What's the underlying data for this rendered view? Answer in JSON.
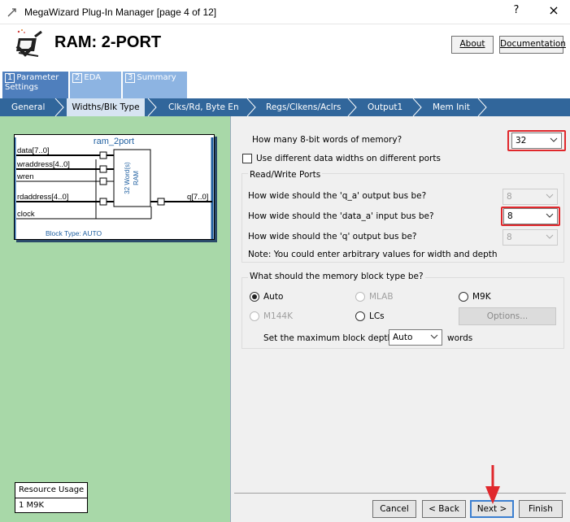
{
  "window": {
    "title": "MegaWizard Plug-In Manager [page 4 of 12]",
    "help": "?",
    "close": "×"
  },
  "header": {
    "title": "RAM: 2-PORT",
    "about_label": "About",
    "documentation_label": "Documentation"
  },
  "steps": [
    {
      "num": "1",
      "label": "Parameter Settings"
    },
    {
      "num": "2",
      "label": "EDA"
    },
    {
      "num": "3",
      "label": "Summary"
    }
  ],
  "tabs": [
    "General",
    "Widths/Blk Type",
    "Clks/Rd, Byte En",
    "Regs/Clkens/Aclrs",
    "Output1",
    "Mem Init"
  ],
  "symbol": {
    "name": "ram_2port",
    "inputs": [
      "data[7..0]",
      "wraddress[4..0]",
      "wren",
      "rdaddress[4..0]",
      "clock"
    ],
    "output": "q[7..0]",
    "block_text_1": "32 Word(s)",
    "block_text_2": "RAM",
    "block_type": "Block Type: AUTO"
  },
  "resource": {
    "title": "Resource Usage",
    "value": "1 M9K"
  },
  "form": {
    "words_question": "How many 8-bit words of memory?",
    "words_value": "32",
    "diff_widths_label": "Use different data widths on different ports",
    "rw_group_title": "Read/Write Ports",
    "q_a_question": "How wide should the 'q_a' output bus be?",
    "q_a_value": "8",
    "data_a_question": "How wide should the 'data_a' input bus be?",
    "data_a_value": "8",
    "q_question": "How wide should the 'q' output bus be?",
    "q_value": "8",
    "note": "Note: You could enter arbitrary values for width and depth",
    "block_group_title": "What should the memory block type be?",
    "opt_auto": "Auto",
    "opt_mlab": "MLAB",
    "opt_m9k": "M9K",
    "opt_m144k": "M144K",
    "opt_lcs": "LCs",
    "options_label": "Options...",
    "depth_label": "Set the maximum block depth to",
    "depth_value": "Auto",
    "depth_unit": "words"
  },
  "footer": {
    "cancel": "Cancel",
    "back": "< Back",
    "next": "Next >",
    "finish": "Finish"
  },
  "colors": {
    "tab_bar": "#31669b",
    "left_pane": "#a8d8a8",
    "highlight": "#e0282c",
    "arrow": "#e0282c"
  }
}
